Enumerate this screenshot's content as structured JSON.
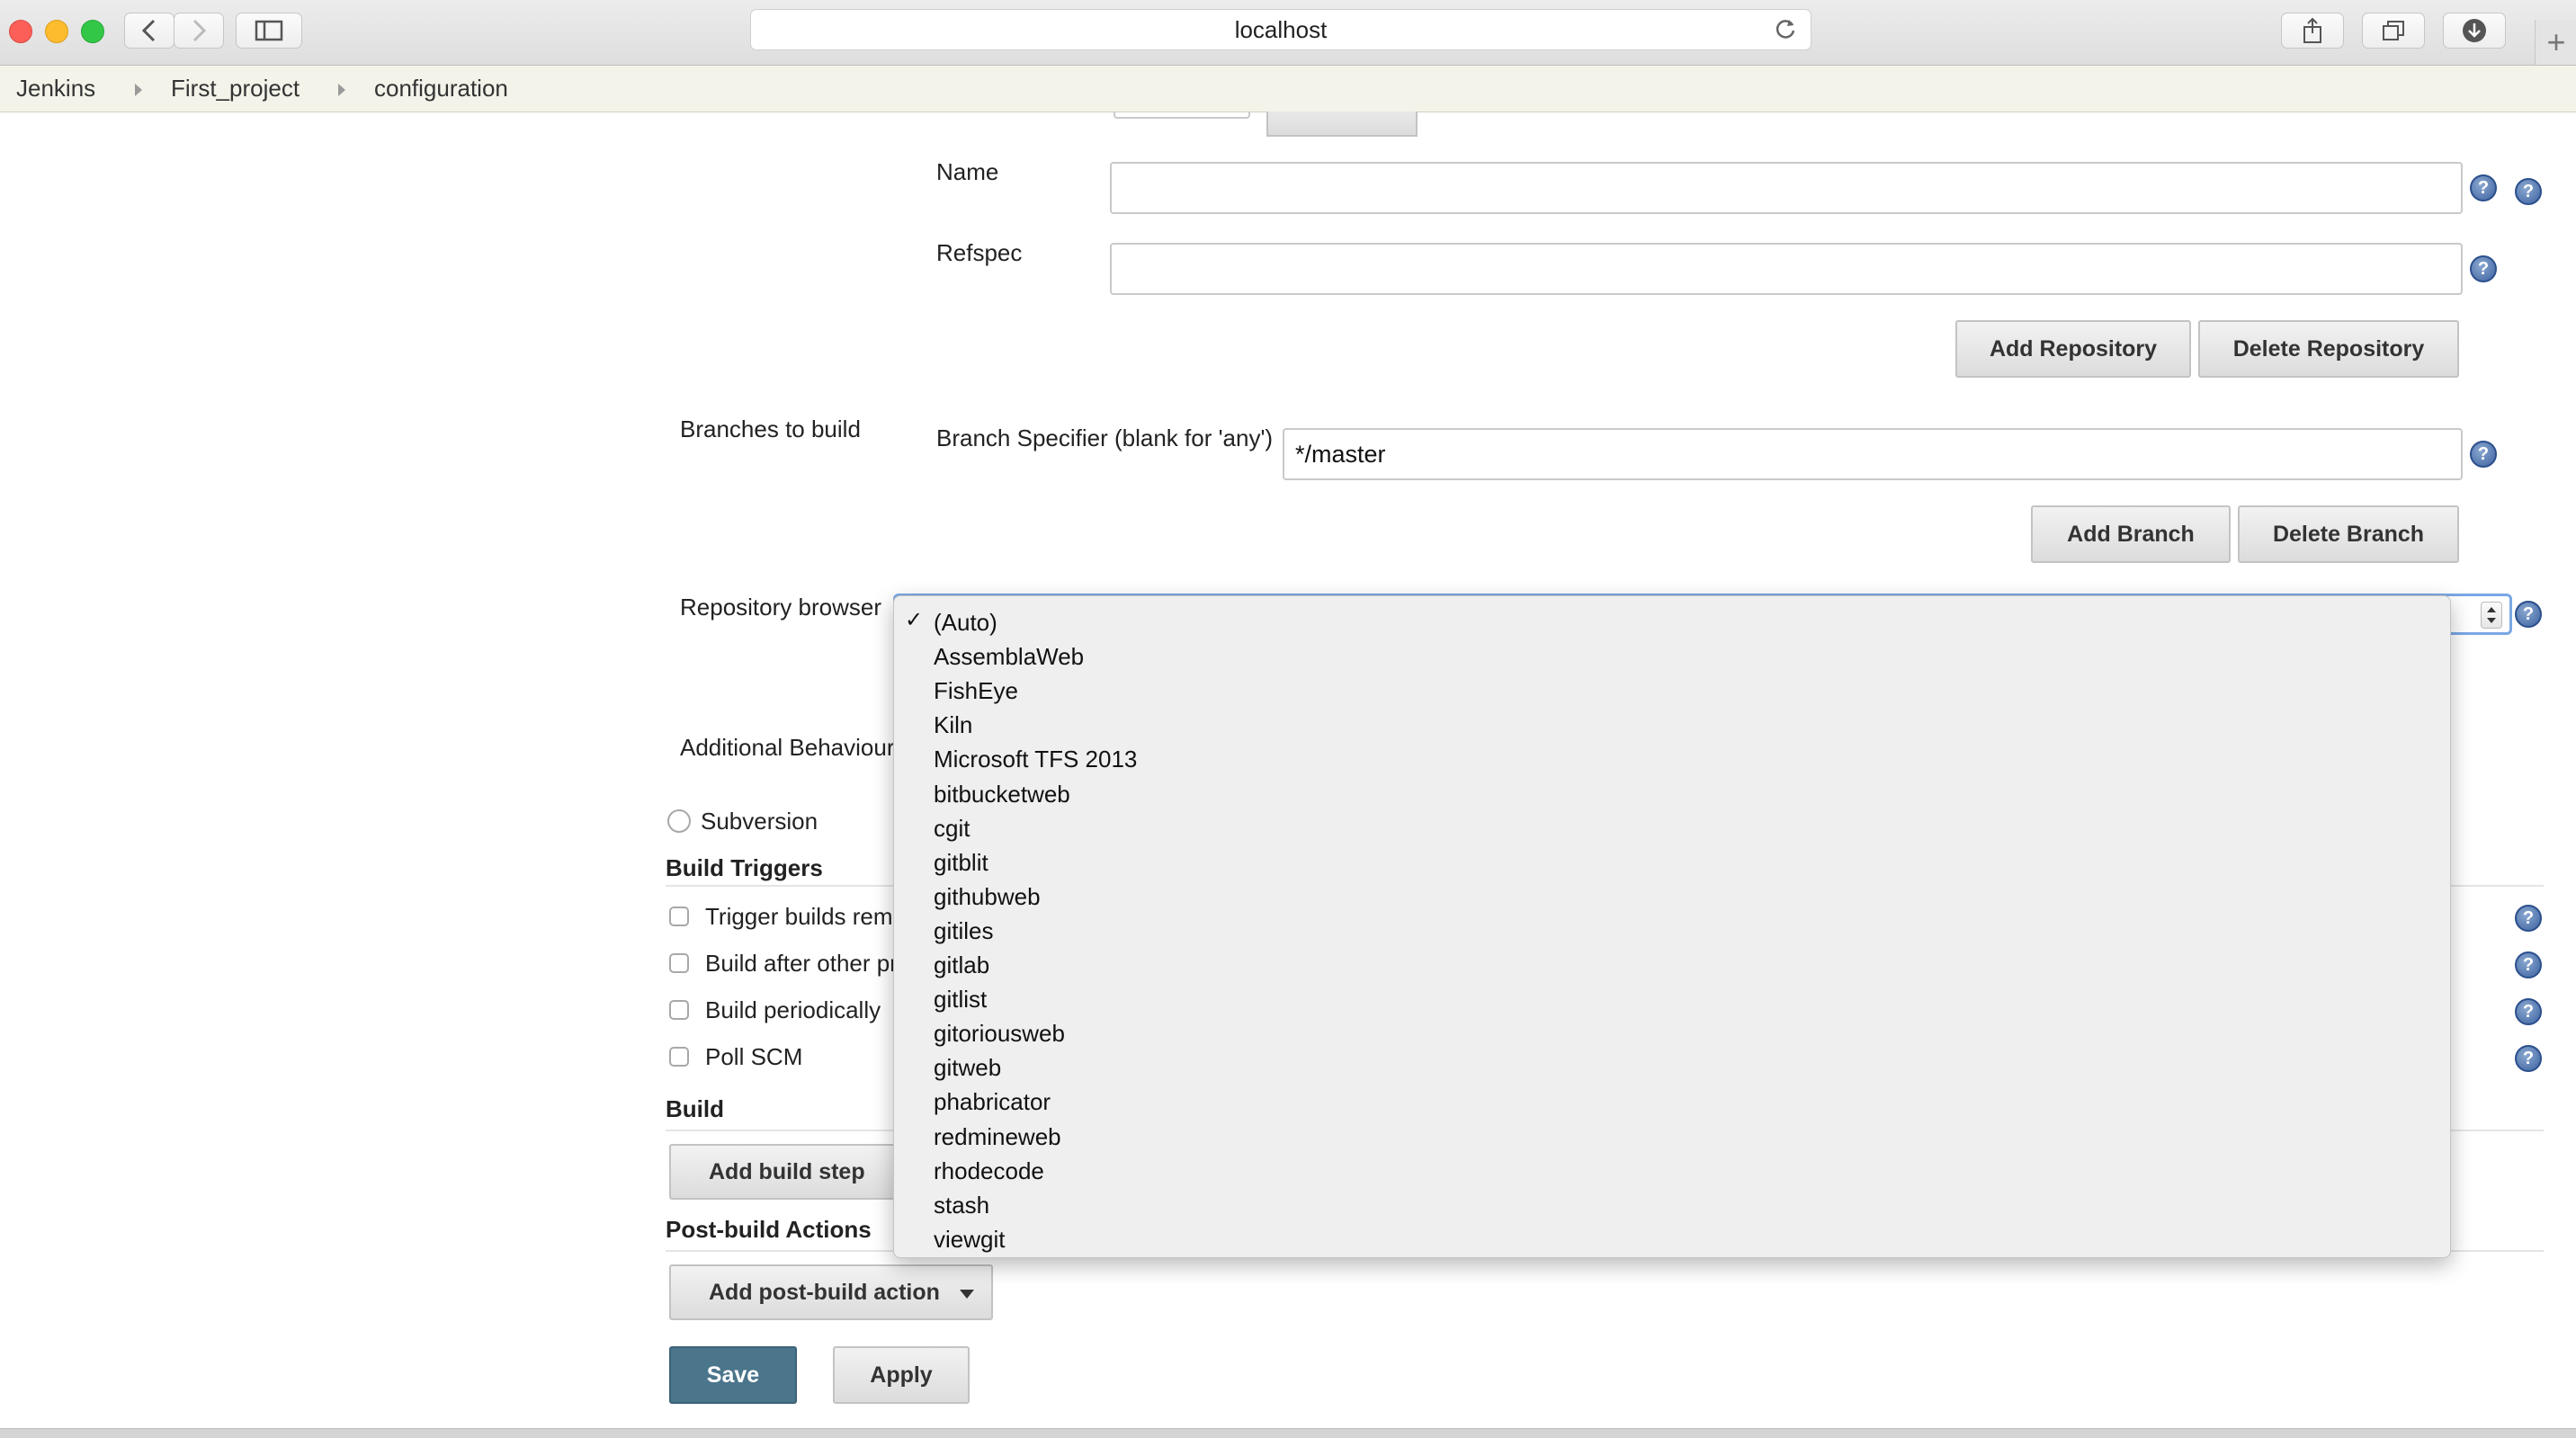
{
  "browser": {
    "url": "localhost",
    "new_tab_label": "+"
  },
  "breadcrumb": [
    "Jenkins",
    "First_project",
    "configuration"
  ],
  "repository": {
    "name_label": "Name",
    "name_value": "",
    "refspec_label": "Refspec",
    "refspec_value": "",
    "add_repository": "Add Repository",
    "delete_repository": "Delete Repository"
  },
  "branches": {
    "section_label": "Branches to build",
    "specifier_label": "Branch Specifier (blank for 'any')",
    "specifier_value": "*/master",
    "add_branch": "Add Branch",
    "delete_branch": "Delete Branch"
  },
  "repo_browser": {
    "label": "Repository browser",
    "selected": "(Auto)",
    "check_mark": "✓",
    "options": [
      "(Auto)",
      "AssemblaWeb",
      "FishEye",
      "Kiln",
      "Microsoft TFS 2013",
      "bitbucketweb",
      "cgit",
      "gitblit",
      "githubweb",
      "gitiles",
      "gitlab",
      "gitlist",
      "gitoriousweb",
      "gitweb",
      "phabricator",
      "redmineweb",
      "rhodecode",
      "stash",
      "viewgit"
    ]
  },
  "additional_behaviours": {
    "label": "Additional Behaviour"
  },
  "scm": {
    "subversion_label": "Subversion"
  },
  "build_triggers": {
    "title": "Build Triggers",
    "items": [
      "Trigger builds rem",
      "Build after other pr",
      "Build periodically",
      "Poll SCM"
    ]
  },
  "build": {
    "title": "Build",
    "add_step": "Add build step"
  },
  "post_build": {
    "title": "Post-build Actions",
    "add_action": "Add post-build action"
  },
  "actions": {
    "save": "Save",
    "apply": "Apply"
  },
  "help_glyph": "?",
  "colors": {
    "save_button": "#4b758b",
    "dropdown_focus": "#7aa7e6",
    "breadcrumb_bg": "#f3f3e9"
  },
  "icons": [
    "back-icon",
    "forward-icon",
    "sidebar-icon",
    "reload-icon",
    "share-icon",
    "tabs-icon",
    "download-icon",
    "help-icon",
    "checkmark-icon",
    "dropdown-arrow-icon"
  ]
}
